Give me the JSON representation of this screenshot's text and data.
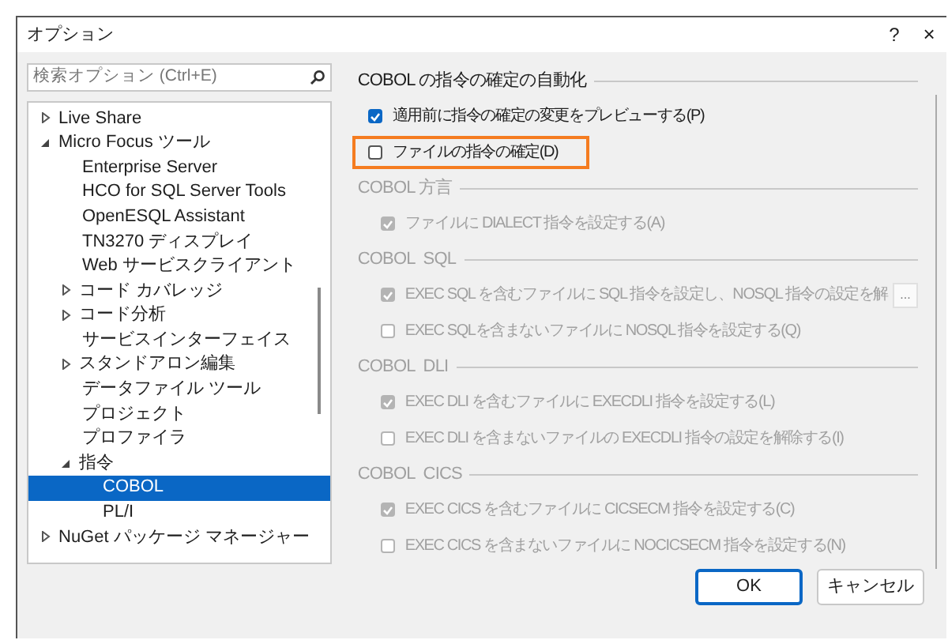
{
  "window": {
    "title": "オプション",
    "help": "?",
    "close": "×"
  },
  "search": {
    "placeholder": "検索オプション (Ctrl+E)"
  },
  "tree": [
    {
      "label": "Live Share",
      "expanded": false,
      "selected": false
    },
    {
      "label": "Micro Focus ツール",
      "expanded": true,
      "selected": false,
      "children": [
        {
          "label": "Enterprise Server",
          "selected": false
        },
        {
          "label": "HCO for SQL Server Tools",
          "selected": false
        },
        {
          "label": "OpenESQL Assistant",
          "selected": false
        },
        {
          "label": "TN3270 ディスプレイ",
          "selected": false
        },
        {
          "label": "Web サービスクライアント",
          "selected": false
        },
        {
          "label": "コード カバレッジ",
          "expanded": false,
          "selected": false
        },
        {
          "label": "コード分析",
          "expanded": false,
          "selected": false
        },
        {
          "label": "サービスインターフェイス",
          "selected": false
        },
        {
          "label": "スタンドアロン編集",
          "expanded": false,
          "selected": false
        },
        {
          "label": "データファイル ツール",
          "selected": false
        },
        {
          "label": "プロジェクト",
          "selected": false
        },
        {
          "label": "プロファイラ",
          "selected": false
        },
        {
          "label": "指令",
          "expanded": true,
          "selected": false,
          "children": [
            {
              "label": "COBOL",
              "selected": true
            },
            {
              "label": "PL/I",
              "selected": false
            }
          ]
        }
      ]
    },
    {
      "label": "NuGet パッケージ マネージャー",
      "expanded": false,
      "selected": false
    }
  ],
  "groups": [
    {
      "title": "COBOL の指令の確定の自動化",
      "disabled": false,
      "options": [
        {
          "label": "適用前に指令の確定の変更をプレビューする(P)",
          "checked": true,
          "highlighted": false
        },
        {
          "label": "ファイルの指令の確定(D)",
          "checked": false,
          "highlighted": true
        }
      ]
    },
    {
      "title": "COBOL 方言",
      "disabled": true,
      "options": [
        {
          "label": "ファイルに DIALECT 指令を設定する(A)",
          "checked": true,
          "highlighted": false
        }
      ]
    },
    {
      "title": "COBOL  SQL",
      "disabled": true,
      "options": [
        {
          "label": "EXEC SQL を含むファイルに SQL 指令を設定し、NOSQL 指令の設定を解",
          "checked": true,
          "highlighted": false,
          "more": "..."
        },
        {
          "label": "EXEC SQLを含まないファイルに NOSQL 指令を設定する(Q)",
          "checked": false,
          "highlighted": false
        }
      ]
    },
    {
      "title": "COBOL  DLI",
      "disabled": true,
      "options": [
        {
          "label": "EXEC DLI を含むファイルに EXECDLI 指令を設定する(L)",
          "checked": true,
          "highlighted": false
        },
        {
          "label": "EXEC DLI を含まないファイルの EXECDLI 指令の設定を解除する(I)",
          "checked": false,
          "highlighted": false
        }
      ]
    },
    {
      "title": "COBOL  CICS",
      "disabled": true,
      "options": [
        {
          "label": "EXEC CICS を含むファイルに CICSECM 指令を設定する(C)",
          "checked": true,
          "highlighted": false
        },
        {
          "label": "EXEC CICS を含まないファイルに NOCICSECM 指令を設定する(N)",
          "checked": false,
          "highlighted": false
        }
      ]
    }
  ],
  "buttons": [
    {
      "label": "OK",
      "default": true
    },
    {
      "label": "キャンセル",
      "default": false
    }
  ]
}
